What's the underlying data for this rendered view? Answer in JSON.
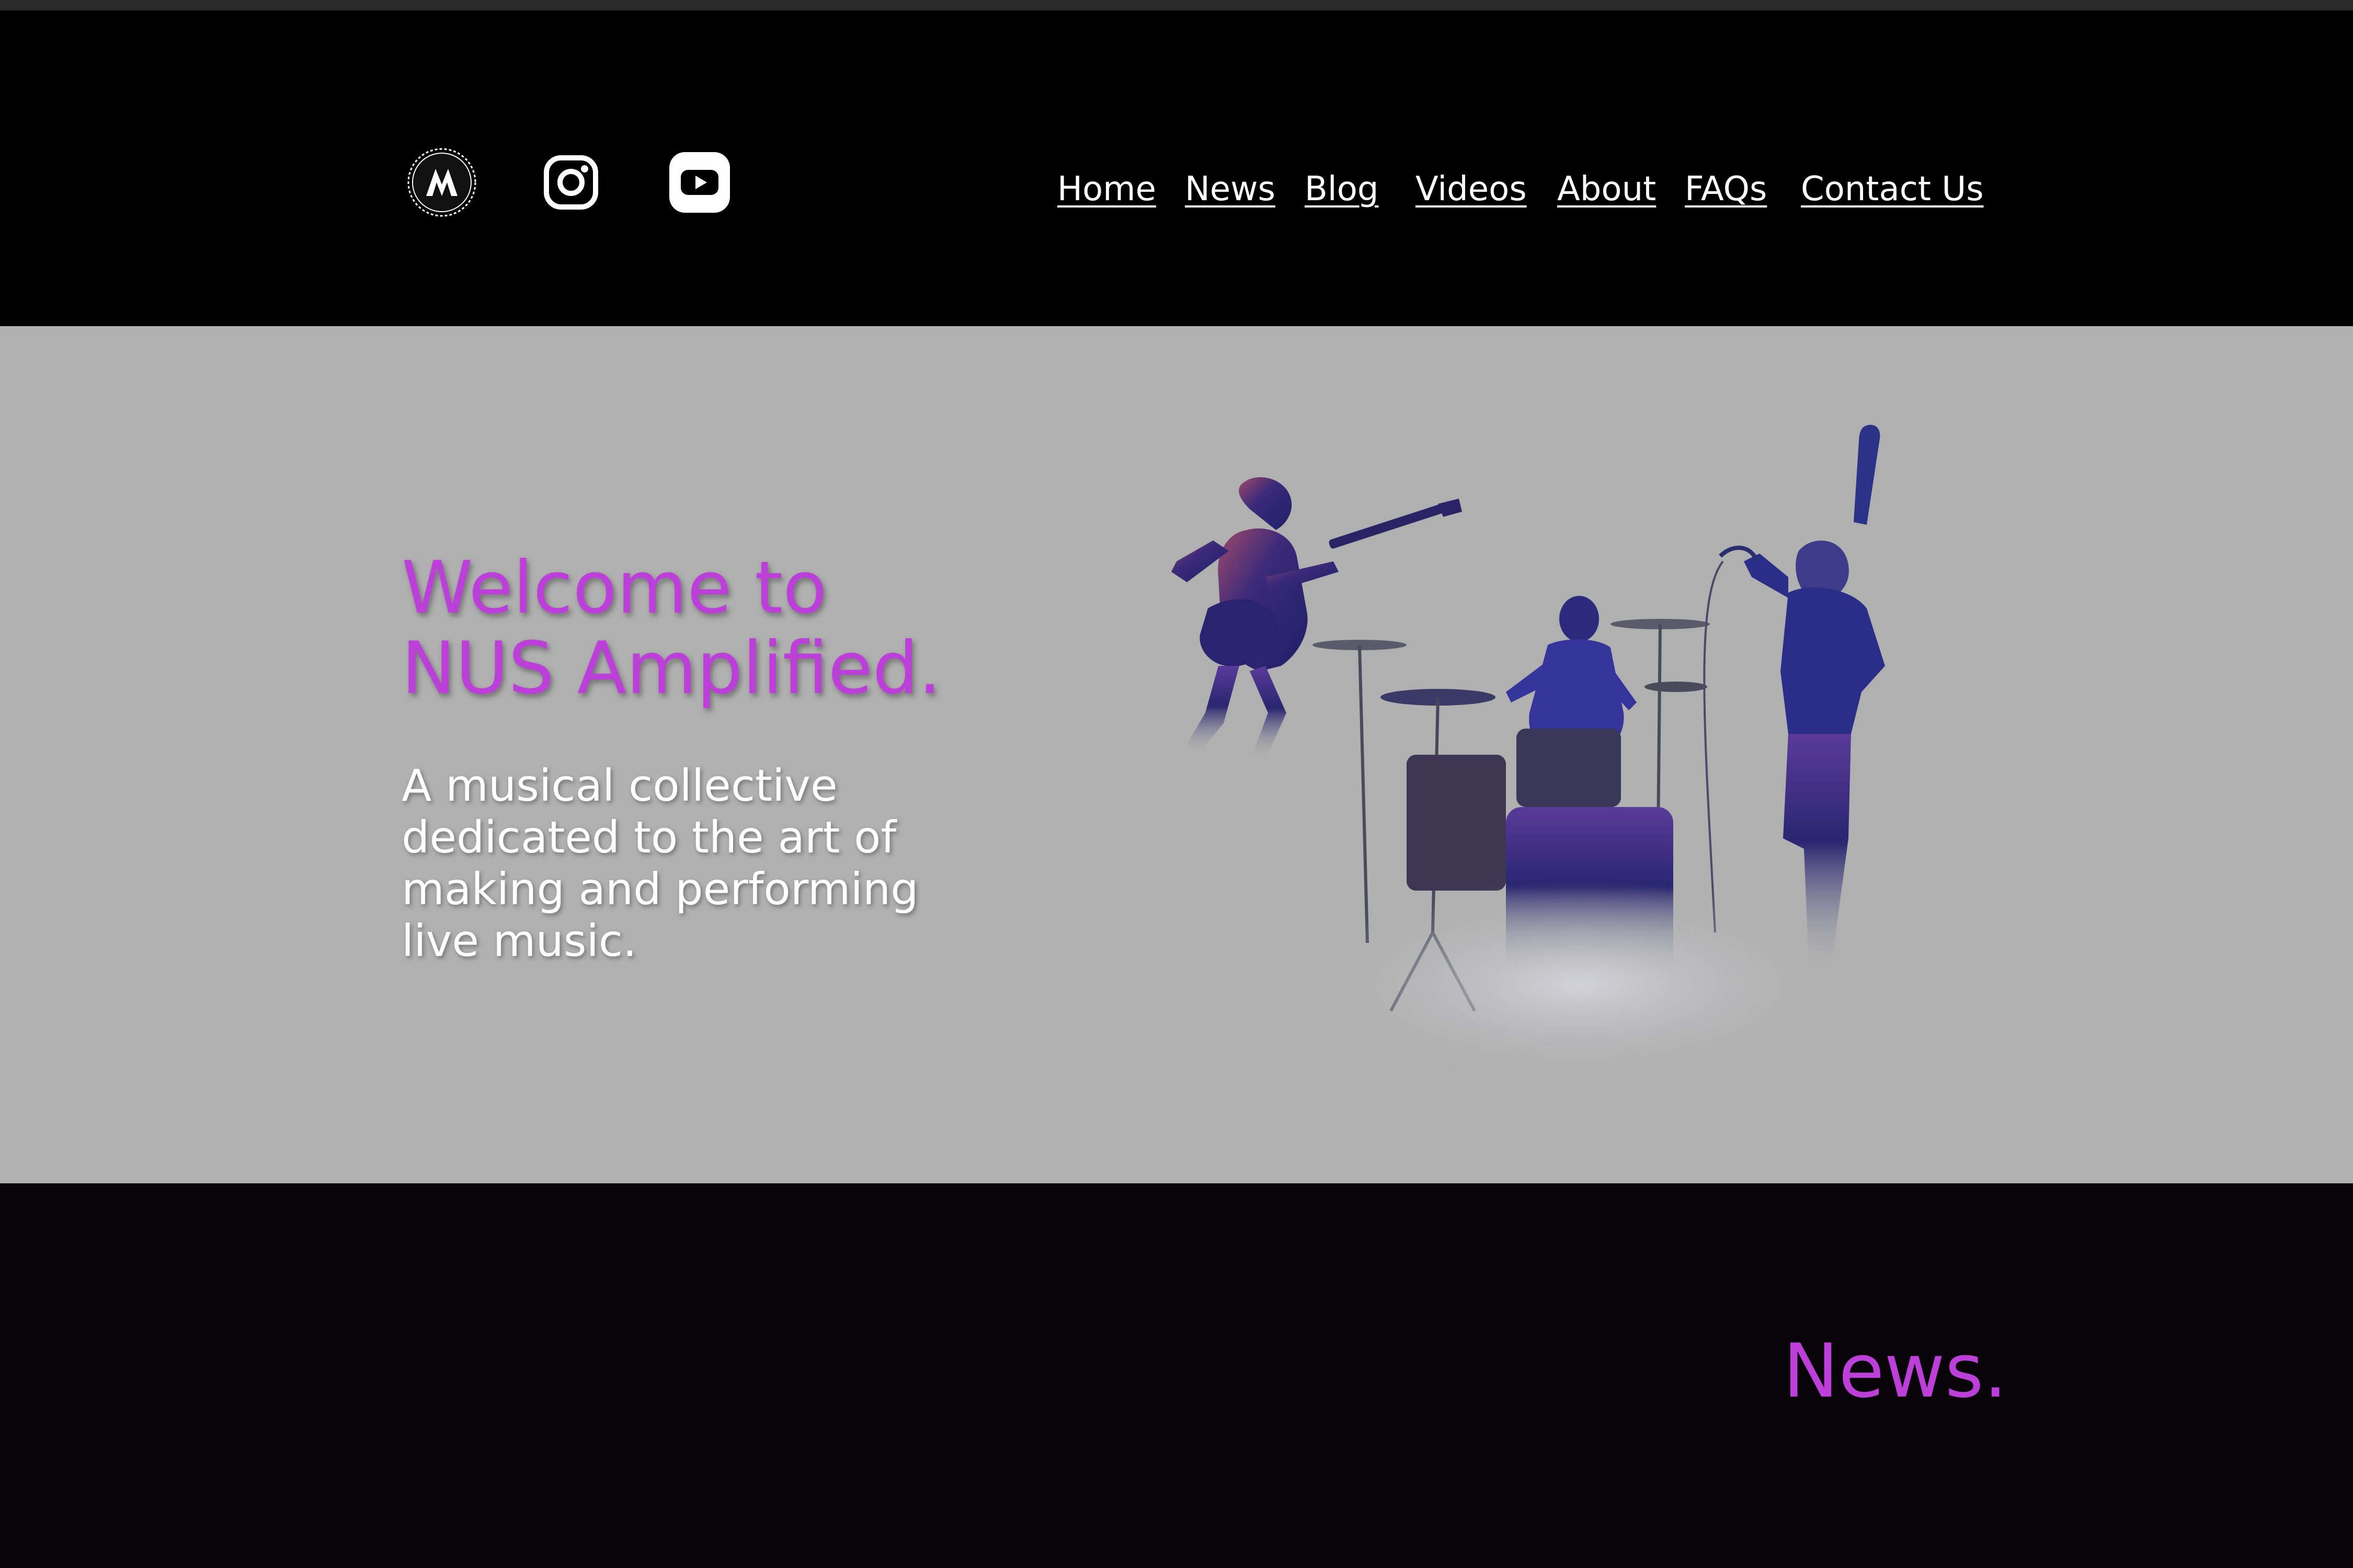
{
  "header": {
    "social": [
      {
        "icon": "amplified-logo-icon"
      },
      {
        "icon": "instagram-icon"
      },
      {
        "icon": "youtube-icon"
      }
    ],
    "nav": [
      "Home",
      "News",
      "Blog",
      "Videos",
      "About",
      "FAQs",
      "Contact Us"
    ]
  },
  "hero": {
    "title_line1": "Welcome to",
    "title_line2": "NUS Amplified.",
    "subtitle": "A musical collective dedicated to the art of making and performing live music.",
    "image_icon": "band-silhouette-image"
  },
  "news": {
    "title": "News."
  },
  "colors": {
    "accent": "#bb3fd8",
    "header_bg": "#000000",
    "hero_bg": "#b0b0b0",
    "news_bg": "#090409",
    "text_light": "#ffffff"
  }
}
